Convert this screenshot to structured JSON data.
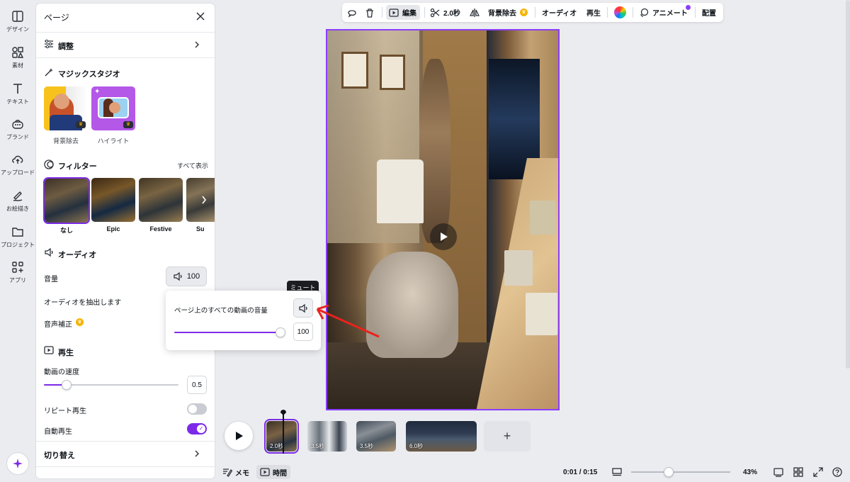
{
  "rail": {
    "items": [
      {
        "label": "デザイン",
        "icon": "layout-icon"
      },
      {
        "label": "素材",
        "icon": "elements-icon"
      },
      {
        "label": "テキスト",
        "icon": "text-icon"
      },
      {
        "label": "ブランド",
        "icon": "brand-icon"
      },
      {
        "label": "アップロード",
        "icon": "upload-cloud-icon"
      },
      {
        "label": "お絵描き",
        "icon": "draw-icon"
      },
      {
        "label": "プロジェクト",
        "icon": "folder-icon"
      },
      {
        "label": "アプリ",
        "icon": "apps-icon"
      }
    ]
  },
  "panel": {
    "title": "ページ",
    "adjust": "調整",
    "magic_studio": "マジックスタジオ",
    "magic_items": [
      {
        "label": "背景除去"
      },
      {
        "label": "ハイライト"
      }
    ],
    "filter_title": "フィルター",
    "show_all": "すべて表示",
    "filters": [
      {
        "label": "なし"
      },
      {
        "label": "Epic"
      },
      {
        "label": "Festive"
      },
      {
        "label": "Su"
      }
    ],
    "audio_title": "オーディオ",
    "volume_label": "音量",
    "volume_value": "100",
    "extract_audio": "オーディオを抽出します",
    "audio_correction": "音声補正",
    "playback_title": "再生",
    "speed_label": "動画の速度",
    "speed_value": "0.5",
    "repeat_label": "リピート再生",
    "repeat_on": false,
    "autoplay_label": "自動再生",
    "autoplay_on": true,
    "transition_label": "切り替え"
  },
  "toolbar": {
    "edit": "編集",
    "duration": "2.0秒",
    "bg_remove": "背景除去",
    "audio": "オーディオ",
    "playback": "再生",
    "animate": "アニメート",
    "position": "配置"
  },
  "popover": {
    "tooltip": "ミュート",
    "label": "ページ上のすべての動画の音量",
    "value": "100",
    "level": 1.0
  },
  "timeline": {
    "clips": [
      {
        "duration": "2.0秒"
      },
      {
        "duration": "3.5秒"
      },
      {
        "duration": "3.5秒"
      },
      {
        "duration": "6.0秒"
      }
    ],
    "add": "+"
  },
  "bottom": {
    "notes": "メモ",
    "timer": "時間",
    "time": "0:01 / 0:15",
    "zoom": "43%"
  },
  "colors": {
    "accent": "#7d2ae8",
    "crown": "#f5b400"
  }
}
